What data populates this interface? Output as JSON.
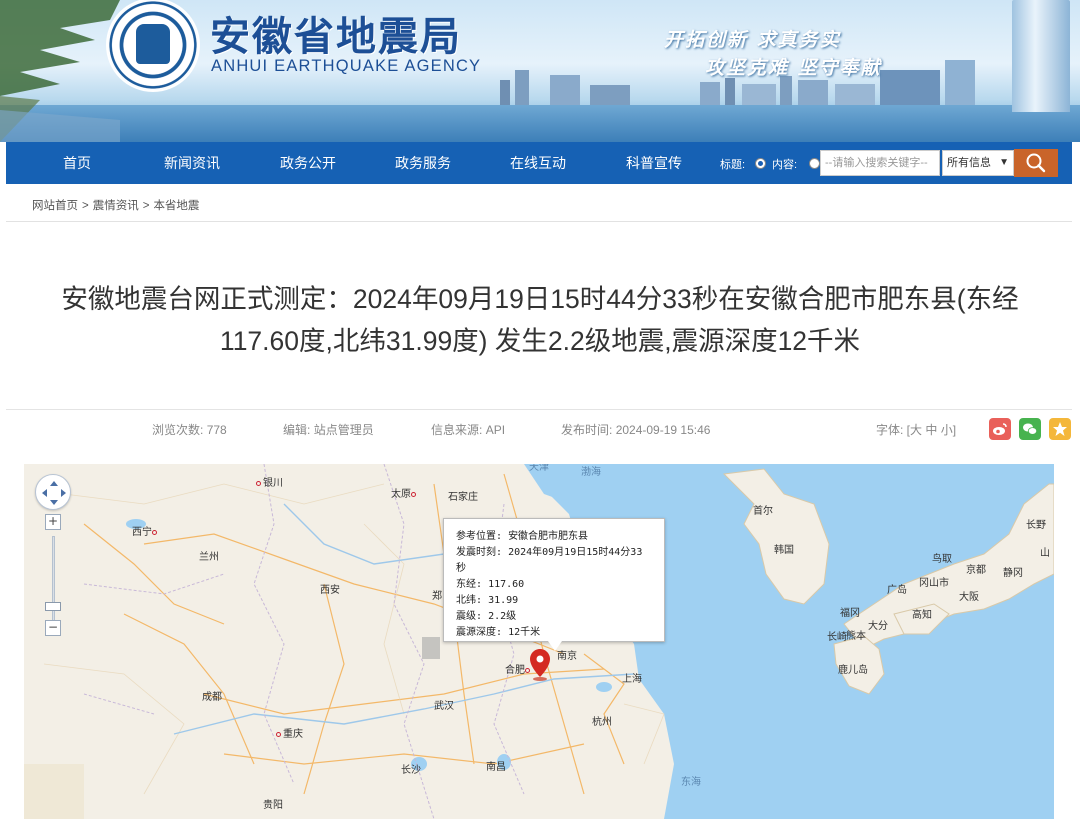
{
  "header": {
    "title_cn": "安徽省地震局",
    "title_en": "ANHUI EARTHQUAKE AGENCY",
    "slogan_line1": "开拓创新  求真务实",
    "slogan_line2": "攻坚克难  坚守奉献",
    "colors": {
      "brand": "#1661b4",
      "search_button": "#c9642a"
    }
  },
  "nav": {
    "items": [
      "首页",
      "新闻资讯",
      "政务公开",
      "政务服务",
      "在线互动",
      "科普宣传"
    ],
    "search": {
      "title_label": "标题:",
      "content_label": "内容:",
      "selected_mode": "title",
      "placeholder": "--请输入搜索关键字--",
      "scope_selected": "所有信息"
    }
  },
  "breadcrumb": [
    "网站首页",
    "震情资讯",
    "本省地震"
  ],
  "article": {
    "title_line1": "安徽地震台网正式测定：2024年09月19日15时44分33秒在安徽合肥市肥东县(东经",
    "title_line2": "117.60度,北纬31.99度) 发生2.2级地震,震源深度12千米",
    "meta": {
      "views_label": "浏览次数:",
      "views": "778",
      "editor_label": "编辑:",
      "editor": "站点管理员",
      "source_label": "信息来源:",
      "source": "API",
      "published_label": "发布时间:",
      "published": "2024-09-19 15:46",
      "font_label": "字体: [",
      "font_sizes": [
        "大",
        "中",
        "小"
      ],
      "font_close": "]"
    },
    "share_icons": [
      "weibo-icon",
      "wechat-icon",
      "favorite-star-icon"
    ]
  },
  "map": {
    "popup": {
      "location_label": "参考位置:",
      "location": "安徽合肥市肥东县",
      "time_label": "发震时刻:",
      "time": "2024年09月19日15时44分33秒",
      "lon_label": "东经:",
      "lon": "117.60",
      "lat_label": "北纬:",
      "lat": "31.99",
      "mag_label": "震级:",
      "mag": "2.2级",
      "depth_label": "震源深度:",
      "depth": "12千米"
    },
    "labels": {
      "yinchuan": "银川",
      "taiyuan": "太原",
      "shijiazhuang": "石家庄",
      "tianjin": "天津",
      "bohai": "渤海",
      "xining": "西宁",
      "lanzhou": "兰州",
      "xian": "西安",
      "zheng": "郑",
      "hefei": "合肥",
      "nanjing": "南京",
      "shanghai": "上海",
      "chengdu": "成都",
      "wuhan": "武汉",
      "hangzhou": "杭州",
      "chongqing": "重庆",
      "changsha": "长沙",
      "nanchang": "南昌",
      "donghai": "东海",
      "guiyang": "贵阳",
      "shouer": "首尔",
      "hanguo": "韩国",
      "changye": "长野",
      "shan": "山",
      "niaoqu": "鸟取",
      "jingdu": "京都",
      "jinggang": "静冈",
      "guangdao": "广岛",
      "gangshanshi": "冈山市",
      "daban": "大阪",
      "fugang": "福冈",
      "gaozhi": "高知",
      "changqi": "长崎",
      "xionben": "熊本",
      "dafen": "大分",
      "luerdao": "鹿儿岛"
    }
  }
}
